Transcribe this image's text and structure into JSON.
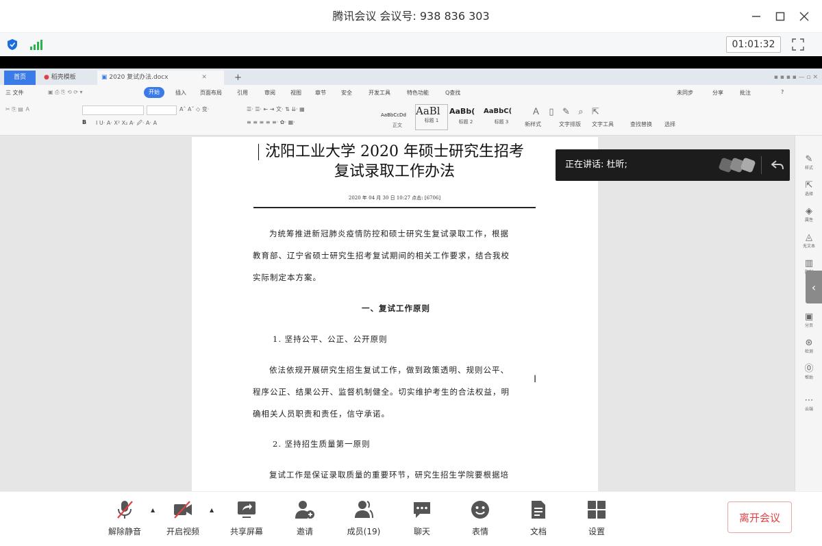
{
  "window": {
    "title": "腾讯会议 会议号: 938 836 303"
  },
  "status": {
    "timer": "01:01:32",
    "shield_icon": "shield-icon",
    "signal_icon": "signal-icon"
  },
  "wps": {
    "tabs": [
      "首页",
      "稻壳模板",
      "2020 复试办法.docx"
    ],
    "menu": [
      "三 文件",
      "开始",
      "插入",
      "页面布局",
      "引用",
      "审阅",
      "视图",
      "章节",
      "安全",
      "开发工具",
      "特色功能",
      "Q查找"
    ],
    "menu_right": [
      "未同步",
      "分享",
      "批注",
      "?"
    ],
    "styles": [
      {
        "sample": "AaBbCcDd",
        "label": "正文"
      },
      {
        "sample": "AaBl",
        "label": "标题 1"
      },
      {
        "sample": "AaBb(",
        "label": "标题 2"
      },
      {
        "sample": "AaBbC(",
        "label": "标题 3"
      }
    ],
    "ribbon_right": [
      "新样式",
      "文字排版",
      "文字工具",
      "查找替换",
      "选择"
    ],
    "rail": [
      "样式",
      "选择",
      "属性",
      "无文本",
      "限制",
      "分页",
      "检测",
      "帮助",
      "云端"
    ]
  },
  "document": {
    "title_line1": "沈阳工业大学 2020 年硕士研究生招考",
    "title_line2": "复试录取工作办法",
    "meta": "2020 年 04 月 30 日 10:27    点击: [6706]",
    "intro_lines": [
      "为统筹推进新冠肺炎疫情防控和硕士研究生复试录取工作，根据",
      "教育部、辽宁省硕士研究生招考复试期间的相关工作要求，结合我校",
      "实际制定本方案。"
    ],
    "section1": "一、复试工作原则",
    "item1": "1. 坚持公平、公正、公开原则",
    "item1_body": [
      "依法依规开展研究生招生复试工作，做到政策透明、规则公平、",
      "程序公正、结果公开、监督机制健全。切实维护考生的合法权益，明",
      "确相关人员职责和责任，信守承诺。"
    ],
    "item2": "2. 坚持招生质量第一原则",
    "item2_body": "复试工作是保证录取质量的重要环节，研究生招生学院要根据培"
  },
  "speaker": {
    "label": "正在讲话: 杜昕;"
  },
  "toolbar": {
    "unmute": "解除静音",
    "video": "开启视频",
    "share": "共享屏幕",
    "invite": "邀请",
    "members": "成员(19)",
    "chat": "聊天",
    "emoji": "表情",
    "docs": "文档",
    "settings": "设置",
    "leave": "离开会议"
  }
}
